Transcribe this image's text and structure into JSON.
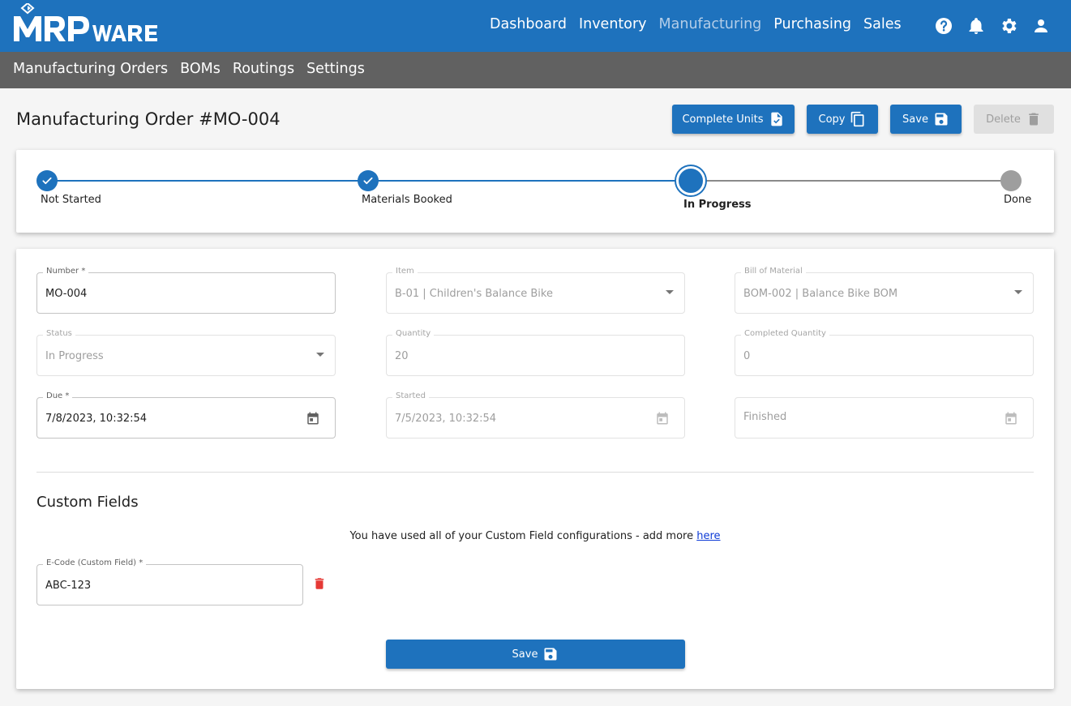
{
  "brand": {
    "logo_text": "MRPWARE",
    "color": "#1e72bd"
  },
  "nav": {
    "main": [
      "Dashboard",
      "Inventory",
      "Manufacturing",
      "Purchasing",
      "Sales"
    ],
    "active": "Manufacturing",
    "icons": [
      "help-icon",
      "bell-icon",
      "gear-icon",
      "user-icon"
    ],
    "sub": [
      "Manufacturing Orders",
      "BOMs",
      "Routings",
      "Settings"
    ]
  },
  "page": {
    "title": "Manufacturing Order #MO-004"
  },
  "actions": {
    "complete_units": "Complete Units",
    "copy": "Copy",
    "save": "Save",
    "delete": "Delete"
  },
  "stepper": {
    "steps": [
      "Not Started",
      "Materials Booked",
      "In Progress",
      "Done"
    ],
    "current": "In Progress"
  },
  "form": {
    "number": {
      "label": "Number *",
      "value": "MO-004"
    },
    "item": {
      "label": "Item",
      "value": "B-01 | Children's Balance Bike"
    },
    "bom": {
      "label": "Bill of Material",
      "value": "BOM-002 | Balance Bike BOM"
    },
    "status": {
      "label": "Status",
      "value": "In Progress"
    },
    "quantity": {
      "label": "Quantity",
      "value": "20"
    },
    "completed_quantity": {
      "label": "Completed Quantity",
      "value": "0"
    },
    "due": {
      "label": "Due *",
      "value": "7/8/2023, 10:32:54"
    },
    "started": {
      "label": "Started",
      "value": "7/5/2023, 10:32:54"
    },
    "finished": {
      "placeholder": "Finished"
    }
  },
  "custom_fields": {
    "title": "Custom Fields",
    "note": "You have used all of your Custom Field configurations - add more ",
    "note_link": "here",
    "ecode": {
      "label": "E-Code (Custom Field) *",
      "value": "ABC-123"
    }
  },
  "footer": {
    "save": "Save"
  },
  "colors": {
    "primary": "#1e72bd",
    "subbar": "#616161",
    "danger": "#e53935",
    "pending": "#9e9e9e"
  }
}
